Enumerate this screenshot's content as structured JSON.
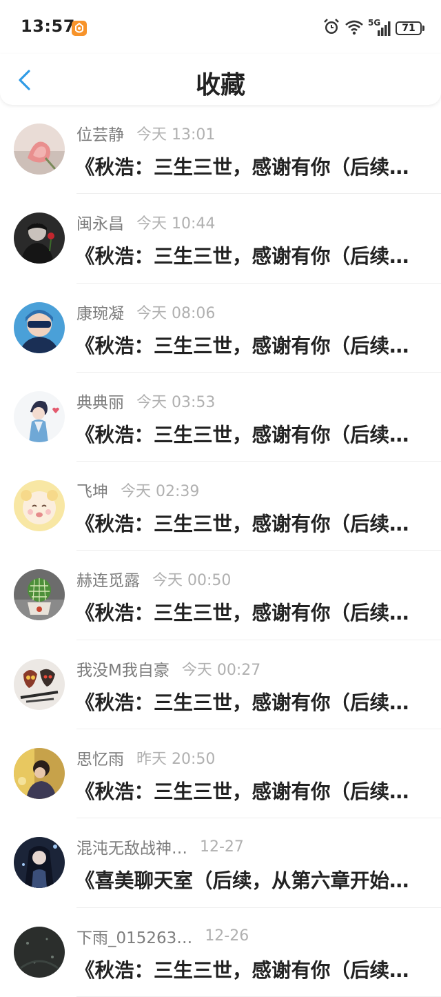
{
  "status_bar": {
    "time": "13:57",
    "network": "5G",
    "battery": "71"
  },
  "header": {
    "title": "收藏"
  },
  "items": [
    {
      "name": "位芸静",
      "time": "今天 13:01",
      "title": "《秋浩：三生三世，感谢有你（后续…",
      "avatar": "rose-flower-avatar"
    },
    {
      "name": "闽永昌",
      "time": "今天 10:44",
      "title": "《秋浩：三生三世，感谢有你（后续…",
      "avatar": "dark-figure-rose-avatar"
    },
    {
      "name": "康琬凝",
      "time": "今天 08:06",
      "title": "《秋浩：三生三世，感谢有你（后续…",
      "avatar": "boy-sunglasses-avatar"
    },
    {
      "name": "典典丽",
      "time": "今天 03:53",
      "title": "《秋浩：三生三世，感谢有你（后续…",
      "avatar": "anime-character-avatar"
    },
    {
      "name": "飞坤",
      "time": "今天 02:39",
      "title": "《秋浩：三生三世，感谢有你（后续…",
      "avatar": "cartoon-bear-avatar"
    },
    {
      "name": "赫连觅露",
      "time": "今天 00:50",
      "title": "《秋浩：三生三世，感谢有你（后续…",
      "avatar": "cactus-avatar"
    },
    {
      "name": "我没M我自豪",
      "time": "今天 00:27",
      "title": "《秋浩：三生三世，感谢有你（后续…",
      "avatar": "masks-weapons-avatar"
    },
    {
      "name": "思忆雨",
      "time": "昨天 20:50",
      "title": "《秋浩：三生三世，感谢有你（后续…",
      "avatar": "girl-photo-avatar"
    },
    {
      "name": "混沌无敌战神…",
      "time": "12-27",
      "title": "《喜美聊天室（后续，从第六章开始…",
      "avatar": "fantasy-warrior-avatar"
    },
    {
      "name": "下雨_015263…",
      "time": "12-26",
      "title": "《秋浩：三生三世，感谢有你（后续…",
      "avatar": "dark-rain-avatar"
    }
  ],
  "colors": {
    "accent": "#2f9be6",
    "name_text": "#7d7d7d",
    "time_text": "#b0b0b0",
    "title_text": "#222222",
    "app_badge": "#f7932a"
  }
}
